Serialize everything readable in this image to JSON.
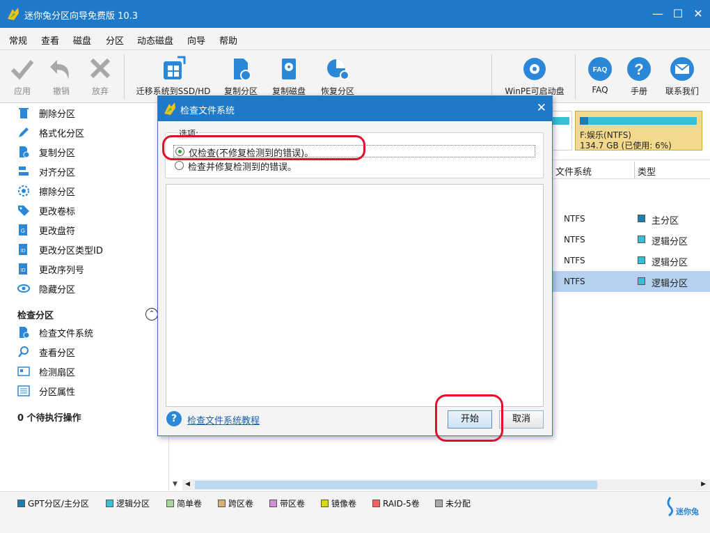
{
  "window": {
    "title": "迷你兔分区向导免费版 10.3",
    "controls": {
      "minimize": "—",
      "maximize": "☐",
      "close": "✕"
    }
  },
  "menu": [
    "常规",
    "查看",
    "磁盘",
    "分区",
    "动态磁盘",
    "向导",
    "帮助"
  ],
  "toolbar": {
    "apply": "应用",
    "undo": "撤销",
    "discard": "放弃",
    "migrate": "迁移系统到SSD/HD",
    "copy_partition": "复制分区",
    "copy_disk": "复制磁盘",
    "recover_partition": "恢复分区",
    "winpe": "WinPE可启动盘",
    "faq": "FAQ",
    "manual": "手册",
    "contact": "联系我们"
  },
  "left_panel": {
    "items": [
      "删除分区",
      "格式化分区",
      "复制分区",
      "对齐分区",
      "擦除分区",
      "更改卷标",
      "更改盘符",
      "更改分区类型ID",
      "更改序列号",
      "隐藏分区"
    ],
    "check_section_title": "检查分区",
    "check_items": [
      "检查文件系统",
      "查看分区",
      "检测扇区",
      "分区属性"
    ],
    "pending_ops": "0 个待执行操作"
  },
  "disk_map": {
    "selected_label": "F:娱乐(NTFS)",
    "selected_info": "134.7 GB (已使用: 6%)",
    "used_fraction": 0.06
  },
  "partition_table": {
    "columns": [
      "文件系统",
      "类型"
    ],
    "rows": [
      {
        "fs": "NTFS",
        "type": "主分区",
        "color": "#1a7fb0"
      },
      {
        "fs": "NTFS",
        "type": "逻辑分区",
        "color": "#35c0d8"
      },
      {
        "fs": "NTFS",
        "type": "逻辑分区",
        "color": "#35c0d8"
      },
      {
        "fs": "NTFS",
        "type": "逻辑分区",
        "color": "#35c0d8"
      }
    ]
  },
  "legend": [
    {
      "label": "GPT分区/主分区",
      "color": "#1a7fb0"
    },
    {
      "label": "逻辑分区",
      "color": "#35c0d8"
    },
    {
      "label": "简单卷",
      "color": "#a8d59a"
    },
    {
      "label": "跨区卷",
      "color": "#d6b070"
    },
    {
      "label": "带区卷",
      "color": "#d48ed8"
    },
    {
      "label": "镜像卷",
      "color": "#dcd417"
    },
    {
      "label": "RAID-5卷",
      "color": "#f06262"
    },
    {
      "label": "未分配",
      "color": "#a8a8a8"
    }
  ],
  "brand": "迷你兔",
  "dialog": {
    "title": "检查文件系统",
    "options_legend": "选项:",
    "option1": "仅检查(不修复检测到的错误)。",
    "option2": "检查并修复检测到的错误。",
    "selected_option": 1,
    "help_link": "检查文件系统教程",
    "help_icon": "?",
    "start_button": "开始",
    "cancel_button": "取消",
    "close": "✕"
  }
}
